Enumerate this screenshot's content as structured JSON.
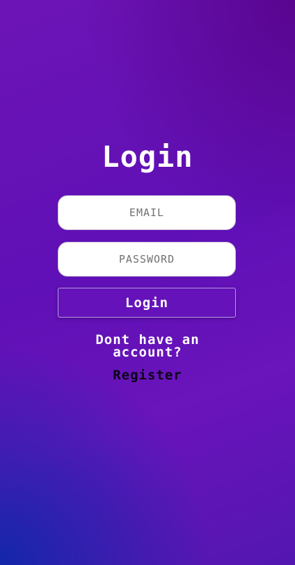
{
  "login_form": {
    "title": "Login",
    "email_placeholder": "EMAIL",
    "password_placeholder": "PASSWORD",
    "submit_label": "Login",
    "signup_prompt": "Dont have an account?",
    "register_link": "Register"
  }
}
